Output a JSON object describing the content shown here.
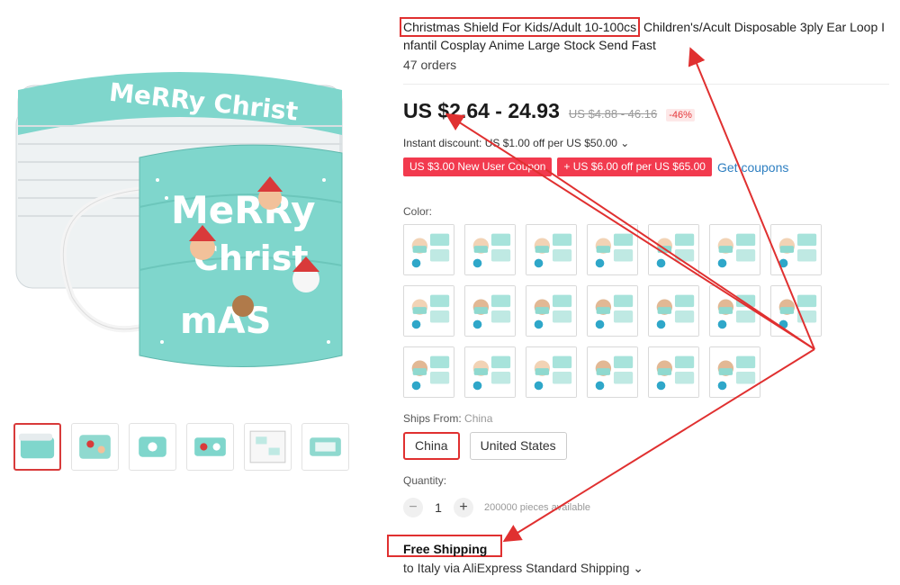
{
  "product": {
    "title_highlight": "Christmas Shield For Kids/Adult 10-100cs",
    "title_rest": " Children's/Acult Disposable 3ply Ear Loop I nfantil Cosplay Anime Large Stock Send Fast",
    "orders": "47 orders"
  },
  "price": {
    "range": "US $2.64 - 24.93",
    "original": "US $4.88 - 46.16",
    "discount_pct": "-46%"
  },
  "discount": {
    "text": "Instant discount: US $1.00 off per US $50.00 ⌄"
  },
  "coupons": {
    "items": [
      "US $3.00 New User Coupon",
      "+ US $6.00 off per US $65.00"
    ],
    "get_label": "Get coupons"
  },
  "color": {
    "label": "Color:"
  },
  "ships": {
    "label": "Ships From:",
    "value": "China",
    "options": [
      "China",
      "United States"
    ]
  },
  "quantity": {
    "label": "Quantity:",
    "minus": "−",
    "plus": "+",
    "value": "1",
    "available": "200000 pieces available"
  },
  "shipping": {
    "free": "Free Shipping",
    "via": "to Italy via AliExpress Standard Shipping ⌄"
  },
  "colors_hex": {
    "mask_teal": "#7fd6cc",
    "accent_red": "#e03030",
    "coupon_red": "#f23a4e",
    "link_blue": "#2e7fc1"
  }
}
